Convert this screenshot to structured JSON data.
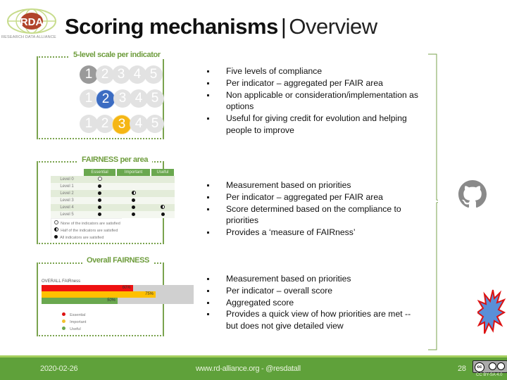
{
  "logo": {
    "acronym": "RDA",
    "tagline": "RESEARCH DATA ALLIANCE"
  },
  "title": {
    "main": "Scoring mechanisms",
    "separator": "|",
    "sub": "Overview"
  },
  "sections": [
    {
      "label": "5-level scale per indicator",
      "scale_rows": [
        {
          "numbers": [
            "1",
            "2",
            "3",
            "4",
            "5"
          ],
          "active": 1
        },
        {
          "numbers": [
            "1",
            "2",
            "3",
            "4",
            "5"
          ],
          "active": 2
        },
        {
          "numbers": [
            "1",
            "2",
            "3",
            "4",
            "5"
          ],
          "active": 3
        }
      ],
      "colors": {
        "level1": "#9a9a9a",
        "level2": "#3b6cc2",
        "level3": "#f5b614"
      },
      "bullets": [
        "Five levels of compliance",
        "Per indicator – aggregated per FAIR area",
        "Non applicable or consideration/implementation as options",
        "Useful for giving credit for evolution and helping people to improve"
      ]
    },
    {
      "label": "FAIRNESS per area",
      "table": {
        "headers": [
          "",
          "Essential",
          "Important",
          "Useful"
        ],
        "rows": [
          {
            "level": "Level 0",
            "cells": [
              "empty",
              "",
              ""
            ]
          },
          {
            "level": "Level 1",
            "cells": [
              "full",
              "",
              ""
            ]
          },
          {
            "level": "Level 2",
            "cells": [
              "full",
              "half",
              ""
            ]
          },
          {
            "level": "Level 3",
            "cells": [
              "full",
              "full",
              ""
            ]
          },
          {
            "level": "Level 4",
            "cells": [
              "full",
              "full",
              "half"
            ]
          },
          {
            "level": "Level 5",
            "cells": [
              "full",
              "full",
              "full"
            ]
          }
        ]
      },
      "legend": [
        {
          "symbol": "empty",
          "text": "None of the indicators are satisfied"
        },
        {
          "symbol": "half",
          "text": "Half of the indicators are satisfied"
        },
        {
          "symbol": "full",
          "text": "All indicators are satisfied"
        }
      ],
      "bullets": [
        "Measurement based on priorities",
        "Per indicator – aggregated per FAIR area",
        "Score determined based on the compliance to priorities",
        "Provides a ‘measure of FAIRness’"
      ]
    },
    {
      "label": "Overall FAIRNESS",
      "chart_title": "OVERALL FAIRness",
      "bars": [
        {
          "name": "Essential",
          "value": 60,
          "label": "60%",
          "color": "#ee1111"
        },
        {
          "name": "Important",
          "value": 75,
          "label": "75%",
          "color": "#ffc000"
        },
        {
          "name": "Useful",
          "value": 50,
          "label": "50%",
          "color": "#6aa84f"
        }
      ],
      "legend": [
        {
          "name": "Essential",
          "color": "#dd1111"
        },
        {
          "name": "Important",
          "color": "#f2c12e"
        },
        {
          "name": "Useful",
          "color": "#6aa84f"
        }
      ],
      "bullets": [
        "Measurement based on priorities",
        "Per indicator – overall score",
        "Aggregated score",
        "Provides a quick view of how priorities are met -- but does not give detailed view"
      ]
    }
  ],
  "icons": {
    "github": "github-icon",
    "burst": "explosion-icon"
  },
  "footer": {
    "date": "2020-02-26",
    "center": "www.rd-alliance.org -  @resdatall",
    "page": "28",
    "license": "CC BY-SA 4.0",
    "license_badge": "cc by sa"
  },
  "colors": {
    "brand_green": "#5fa13a",
    "frame_green": "#7aa34e",
    "footer_light": "#a5cf5e"
  }
}
